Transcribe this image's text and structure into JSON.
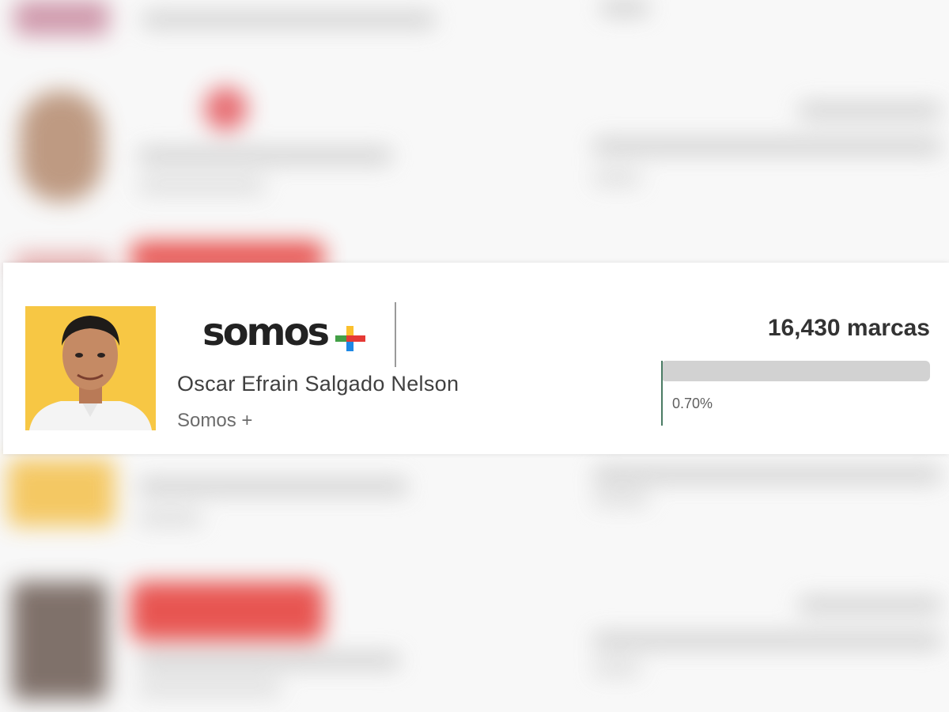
{
  "candidate": {
    "name": "Oscar Efrain Salgado Nelson",
    "party": "Somos +",
    "votes_label": "16,430 marcas",
    "percent_label": "0.70%",
    "percent_value": 0.007,
    "photo_bg_color": "#f7c744"
  },
  "logo": {
    "text": "somos",
    "plus_colors": [
      "#43a047",
      "#fbc02d",
      "#e53935",
      "#1e88e5"
    ]
  },
  "colors": {
    "bar_track": "#d2d2d2",
    "marker": "#4a7b64"
  }
}
